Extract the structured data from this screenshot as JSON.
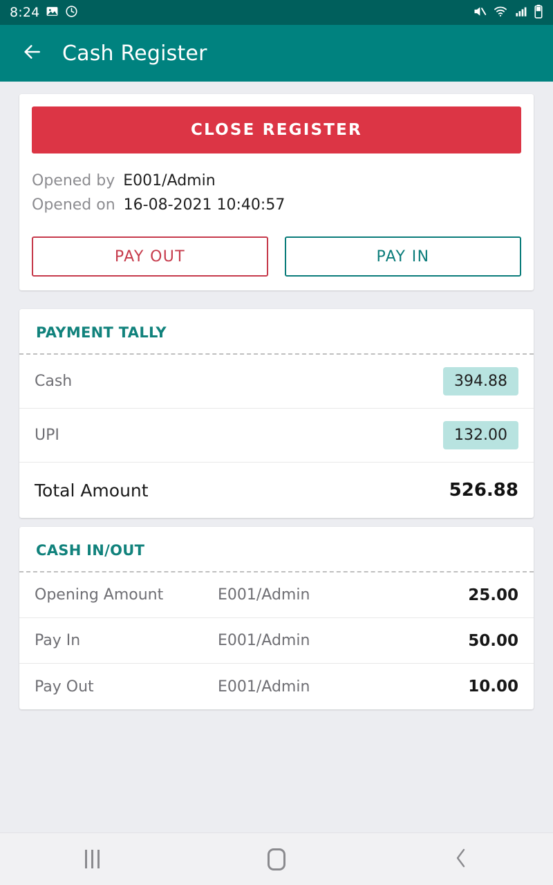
{
  "status_bar": {
    "time": "8:24",
    "icons_left": [
      "image-icon",
      "alarm-icon"
    ],
    "icons_right": [
      "volume-mute-icon",
      "wifi-icon",
      "cellular-signal-icon",
      "battery-icon"
    ],
    "background_color": "#005F5C"
  },
  "app_bar": {
    "back_icon": "arrow-left-icon",
    "title": "Cash Register",
    "background_color": "#00827F"
  },
  "register_card": {
    "close_button_label": "CLOSE REGISTER",
    "close_button_color": "#DC3545",
    "opened_by_label": "Opened by",
    "opened_by_value": "E001/Admin",
    "opened_on_label": "Opened on",
    "opened_on_value": "16-08-2021 10:40:57",
    "pay_out_label": "PAY OUT",
    "pay_out_color": "#C63A4B",
    "pay_in_label": "PAY IN",
    "pay_in_color": "#0A7C7A"
  },
  "payment_tally": {
    "title": "PAYMENT TALLY",
    "title_color": "#11827C",
    "badge_color": "#B8E3E0",
    "rows": [
      {
        "label": "Cash",
        "amount": "394.88"
      },
      {
        "label": "UPI",
        "amount": "132.00"
      }
    ],
    "total_label": "Total Amount",
    "total_amount": "526.88"
  },
  "cash_in_out": {
    "title": "CASH IN/OUT",
    "title_color": "#11827C",
    "rows": [
      {
        "label": "Opening Amount",
        "user": "E001/Admin",
        "amount": "25.00"
      },
      {
        "label": "Pay In",
        "user": "E001/Admin",
        "amount": "50.00"
      },
      {
        "label": "Pay Out",
        "user": "E001/Admin",
        "amount": "10.00"
      }
    ]
  },
  "nav_bar": {
    "recents_icon": "recents-icon",
    "home_icon": "home-icon",
    "back_icon": "back-chevron-icon",
    "background_color": "#F1F1F3"
  }
}
